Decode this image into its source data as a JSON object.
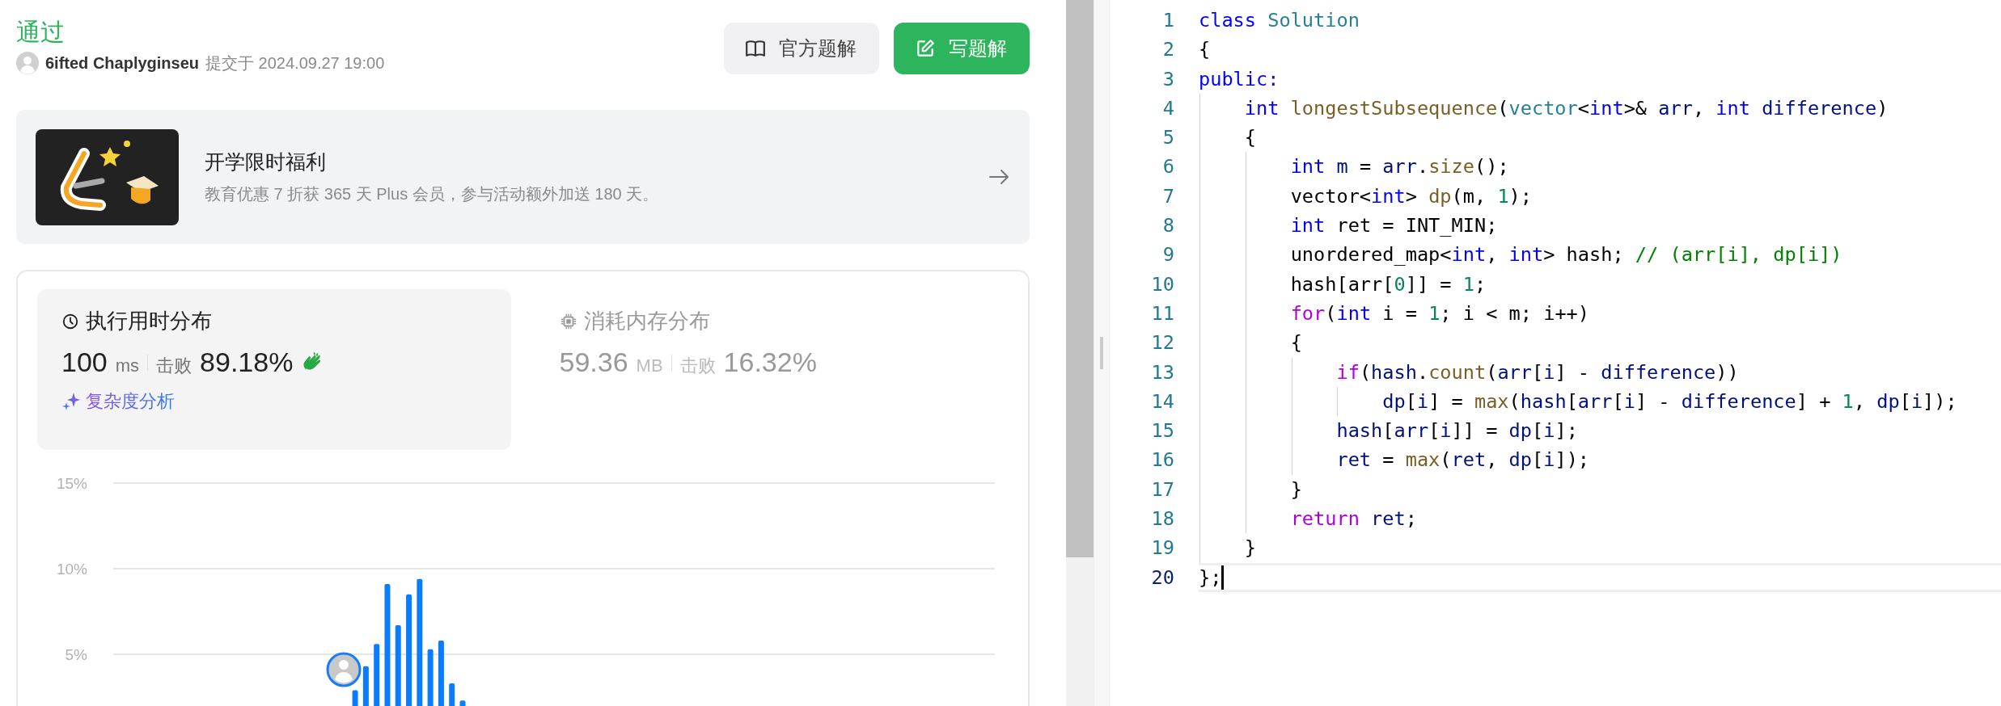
{
  "submission": {
    "status": "通过",
    "user": "6ifted Chaplyginseu",
    "submitted_at": "提交于 2024.09.27 19:00"
  },
  "buttons": [
    {
      "kind": "secondary",
      "label": "官方题解"
    },
    {
      "kind": "primary",
      "label": "写题解"
    }
  ],
  "promo": {
    "title": "开学限时福利",
    "subtitle": "教育优惠 7 折获 365 天 Plus 会员，参与活动额外加送 180 天。"
  },
  "stats": {
    "tabs": [
      {
        "kind": "runtime",
        "title": "执行用时分布",
        "value": "100",
        "unit": "ms",
        "beats_label": "击败",
        "beats": "89.18%",
        "selected": true
      },
      {
        "kind": "memory",
        "title": "消耗内存分布",
        "value": "59.36",
        "unit": "MB",
        "beats_label": "击败",
        "beats": "16.32%",
        "selected": false
      }
    ],
    "analysis_link": "复杂度分析",
    "chart_data": {
      "type": "bar",
      "ylim": [
        0,
        15
      ],
      "yticks": [
        {
          "value": 5,
          "label": "5%"
        },
        {
          "value": 10,
          "label": "10%"
        },
        {
          "value": 15,
          "label": "15%"
        }
      ],
      "values": [
        null,
        null,
        null,
        null,
        null,
        null,
        null,
        null,
        null,
        null,
        null,
        null,
        null,
        null,
        null,
        null,
        null,
        null,
        null,
        null,
        null,
        null,
        2.9,
        4.3,
        5.6,
        9.1,
        6.7,
        8.5,
        9.4,
        5.3,
        5.8,
        3.3,
        2.3,
        null,
        null,
        null,
        null,
        null,
        null,
        null,
        null,
        null,
        null,
        null,
        null,
        null,
        null,
        null,
        null,
        null,
        null,
        null,
        null,
        null,
        null,
        null,
        null,
        null,
        null,
        null,
        null,
        null,
        null,
        null,
        null,
        null,
        null,
        null,
        null,
        null,
        null,
        null,
        null,
        null,
        null,
        null,
        null,
        null,
        null,
        null,
        null,
        null
      ]
    }
  },
  "code": {
    "lines": [
      {
        "number": "1",
        "current": false,
        "tokens": [
          {
            "kind": "keyword",
            "text": "class"
          },
          {
            "kind": "type",
            "text": " Solution"
          }
        ]
      },
      {
        "number": "2",
        "current": false,
        "tokens": [
          {
            "kind": "plain",
            "text": "{"
          }
        ]
      },
      {
        "number": "3",
        "current": false,
        "tokens": [
          {
            "kind": "keyword",
            "text": "public:"
          }
        ]
      },
      {
        "number": "4",
        "current": false,
        "tokens": [
          {
            "kind": "keyword",
            "text": "    int"
          },
          {
            "kind": "function",
            "text": " longestSubsequence"
          },
          {
            "kind": "plain",
            "text": "("
          },
          {
            "kind": "type",
            "text": "vector"
          },
          {
            "kind": "plain",
            "text": "<"
          },
          {
            "kind": "keyword",
            "text": "int"
          },
          {
            "kind": "plain",
            "text": ">& "
          },
          {
            "kind": "variable",
            "text": "arr"
          },
          {
            "kind": "plain",
            "text": ", "
          },
          {
            "kind": "keyword",
            "text": "int"
          },
          {
            "kind": "variable",
            "text": " difference"
          },
          {
            "kind": "plain",
            "text": ")"
          }
        ]
      },
      {
        "number": "5",
        "current": false,
        "tokens": [
          {
            "kind": "plain",
            "text": "    {"
          }
        ]
      },
      {
        "number": "6",
        "current": false,
        "tokens": [
          {
            "kind": "keyword",
            "text": "        int"
          },
          {
            "kind": "variable",
            "text": " m"
          },
          {
            "kind": "plain",
            "text": " = "
          },
          {
            "kind": "variable",
            "text": "arr"
          },
          {
            "kind": "plain",
            "text": "."
          },
          {
            "kind": "function",
            "text": "size"
          },
          {
            "kind": "plain",
            "text": "();"
          }
        ]
      },
      {
        "number": "7",
        "current": false,
        "tokens": [
          {
            "kind": "plain",
            "text": "        vector<"
          },
          {
            "kind": "keyword",
            "text": "int"
          },
          {
            "kind": "plain",
            "text": "> "
          },
          {
            "kind": "function",
            "text": "dp"
          },
          {
            "kind": "plain",
            "text": "(m, "
          },
          {
            "kind": "number",
            "text": "1"
          },
          {
            "kind": "plain",
            "text": ");"
          }
        ]
      },
      {
        "number": "8",
        "current": false,
        "tokens": [
          {
            "kind": "keyword",
            "text": "        int"
          },
          {
            "kind": "plain",
            "text": " ret = INT_MIN;"
          }
        ]
      },
      {
        "number": "9",
        "current": false,
        "tokens": [
          {
            "kind": "plain",
            "text": "        unordered_map<"
          },
          {
            "kind": "keyword",
            "text": "int"
          },
          {
            "kind": "plain",
            "text": ", "
          },
          {
            "kind": "keyword",
            "text": "int"
          },
          {
            "kind": "plain",
            "text": "> hash; "
          },
          {
            "kind": "comment",
            "text": "// (arr[i], dp[i])"
          }
        ]
      },
      {
        "number": "10",
        "current": false,
        "tokens": [
          {
            "kind": "plain",
            "text": "        hash[arr["
          },
          {
            "kind": "number",
            "text": "0"
          },
          {
            "kind": "plain",
            "text": "]] = "
          },
          {
            "kind": "number",
            "text": "1"
          },
          {
            "kind": "plain",
            "text": ";"
          }
        ]
      },
      {
        "number": "11",
        "current": false,
        "tokens": [
          {
            "kind": "control",
            "text": "        for"
          },
          {
            "kind": "plain",
            "text": "("
          },
          {
            "kind": "keyword",
            "text": "int"
          },
          {
            "kind": "plain",
            "text": " i = "
          },
          {
            "kind": "number",
            "text": "1"
          },
          {
            "kind": "plain",
            "text": "; i < m; i++)"
          }
        ]
      },
      {
        "number": "12",
        "current": false,
        "tokens": [
          {
            "kind": "plain",
            "text": "        {"
          }
        ]
      },
      {
        "number": "13",
        "current": false,
        "tokens": [
          {
            "kind": "control",
            "text": "            if"
          },
          {
            "kind": "plain",
            "text": "("
          },
          {
            "kind": "variable",
            "text": "hash"
          },
          {
            "kind": "plain",
            "text": "."
          },
          {
            "kind": "function",
            "text": "count"
          },
          {
            "kind": "plain",
            "text": "("
          },
          {
            "kind": "variable",
            "text": "arr"
          },
          {
            "kind": "plain",
            "text": "["
          },
          {
            "kind": "variable",
            "text": "i"
          },
          {
            "kind": "plain",
            "text": "] - "
          },
          {
            "kind": "variable",
            "text": "difference"
          },
          {
            "kind": "plain",
            "text": "))"
          }
        ]
      },
      {
        "number": "14",
        "current": false,
        "tokens": [
          {
            "kind": "variable",
            "text": "                dp"
          },
          {
            "kind": "plain",
            "text": "["
          },
          {
            "kind": "variable",
            "text": "i"
          },
          {
            "kind": "plain",
            "text": "] = "
          },
          {
            "kind": "function",
            "text": "max"
          },
          {
            "kind": "plain",
            "text": "("
          },
          {
            "kind": "variable",
            "text": "hash"
          },
          {
            "kind": "plain",
            "text": "["
          },
          {
            "kind": "variable",
            "text": "arr"
          },
          {
            "kind": "plain",
            "text": "["
          },
          {
            "kind": "variable",
            "text": "i"
          },
          {
            "kind": "plain",
            "text": "] - "
          },
          {
            "kind": "variable",
            "text": "difference"
          },
          {
            "kind": "plain",
            "text": "] + "
          },
          {
            "kind": "number",
            "text": "1"
          },
          {
            "kind": "plain",
            "text": ", "
          },
          {
            "kind": "variable",
            "text": "dp"
          },
          {
            "kind": "plain",
            "text": "["
          },
          {
            "kind": "variable",
            "text": "i"
          },
          {
            "kind": "plain",
            "text": "]);"
          }
        ]
      },
      {
        "number": "15",
        "current": false,
        "tokens": [
          {
            "kind": "variable",
            "text": "            hash"
          },
          {
            "kind": "plain",
            "text": "["
          },
          {
            "kind": "variable",
            "text": "arr"
          },
          {
            "kind": "plain",
            "text": "["
          },
          {
            "kind": "variable",
            "text": "i"
          },
          {
            "kind": "plain",
            "text": "]] = "
          },
          {
            "kind": "variable",
            "text": "dp"
          },
          {
            "kind": "plain",
            "text": "["
          },
          {
            "kind": "variable",
            "text": "i"
          },
          {
            "kind": "plain",
            "text": "];"
          }
        ]
      },
      {
        "number": "16",
        "current": false,
        "tokens": [
          {
            "kind": "variable",
            "text": "            ret"
          },
          {
            "kind": "plain",
            "text": " = "
          },
          {
            "kind": "function",
            "text": "max"
          },
          {
            "kind": "plain",
            "text": "("
          },
          {
            "kind": "variable",
            "text": "ret"
          },
          {
            "kind": "plain",
            "text": ", "
          },
          {
            "kind": "variable",
            "text": "dp"
          },
          {
            "kind": "plain",
            "text": "["
          },
          {
            "kind": "variable",
            "text": "i"
          },
          {
            "kind": "plain",
            "text": "]);"
          }
        ]
      },
      {
        "number": "17",
        "current": false,
        "tokens": [
          {
            "kind": "plain",
            "text": "        }"
          }
        ]
      },
      {
        "number": "18",
        "current": false,
        "tokens": [
          {
            "kind": "control",
            "text": "        return"
          },
          {
            "kind": "variable",
            "text": " ret"
          },
          {
            "kind": "plain",
            "text": ";"
          }
        ]
      },
      {
        "number": "19",
        "current": false,
        "tokens": [
          {
            "kind": "plain",
            "text": "    }"
          }
        ]
      },
      {
        "number": "20",
        "current": true,
        "tokens": [
          {
            "kind": "plain",
            "text": "};"
          }
        ]
      }
    ]
  }
}
